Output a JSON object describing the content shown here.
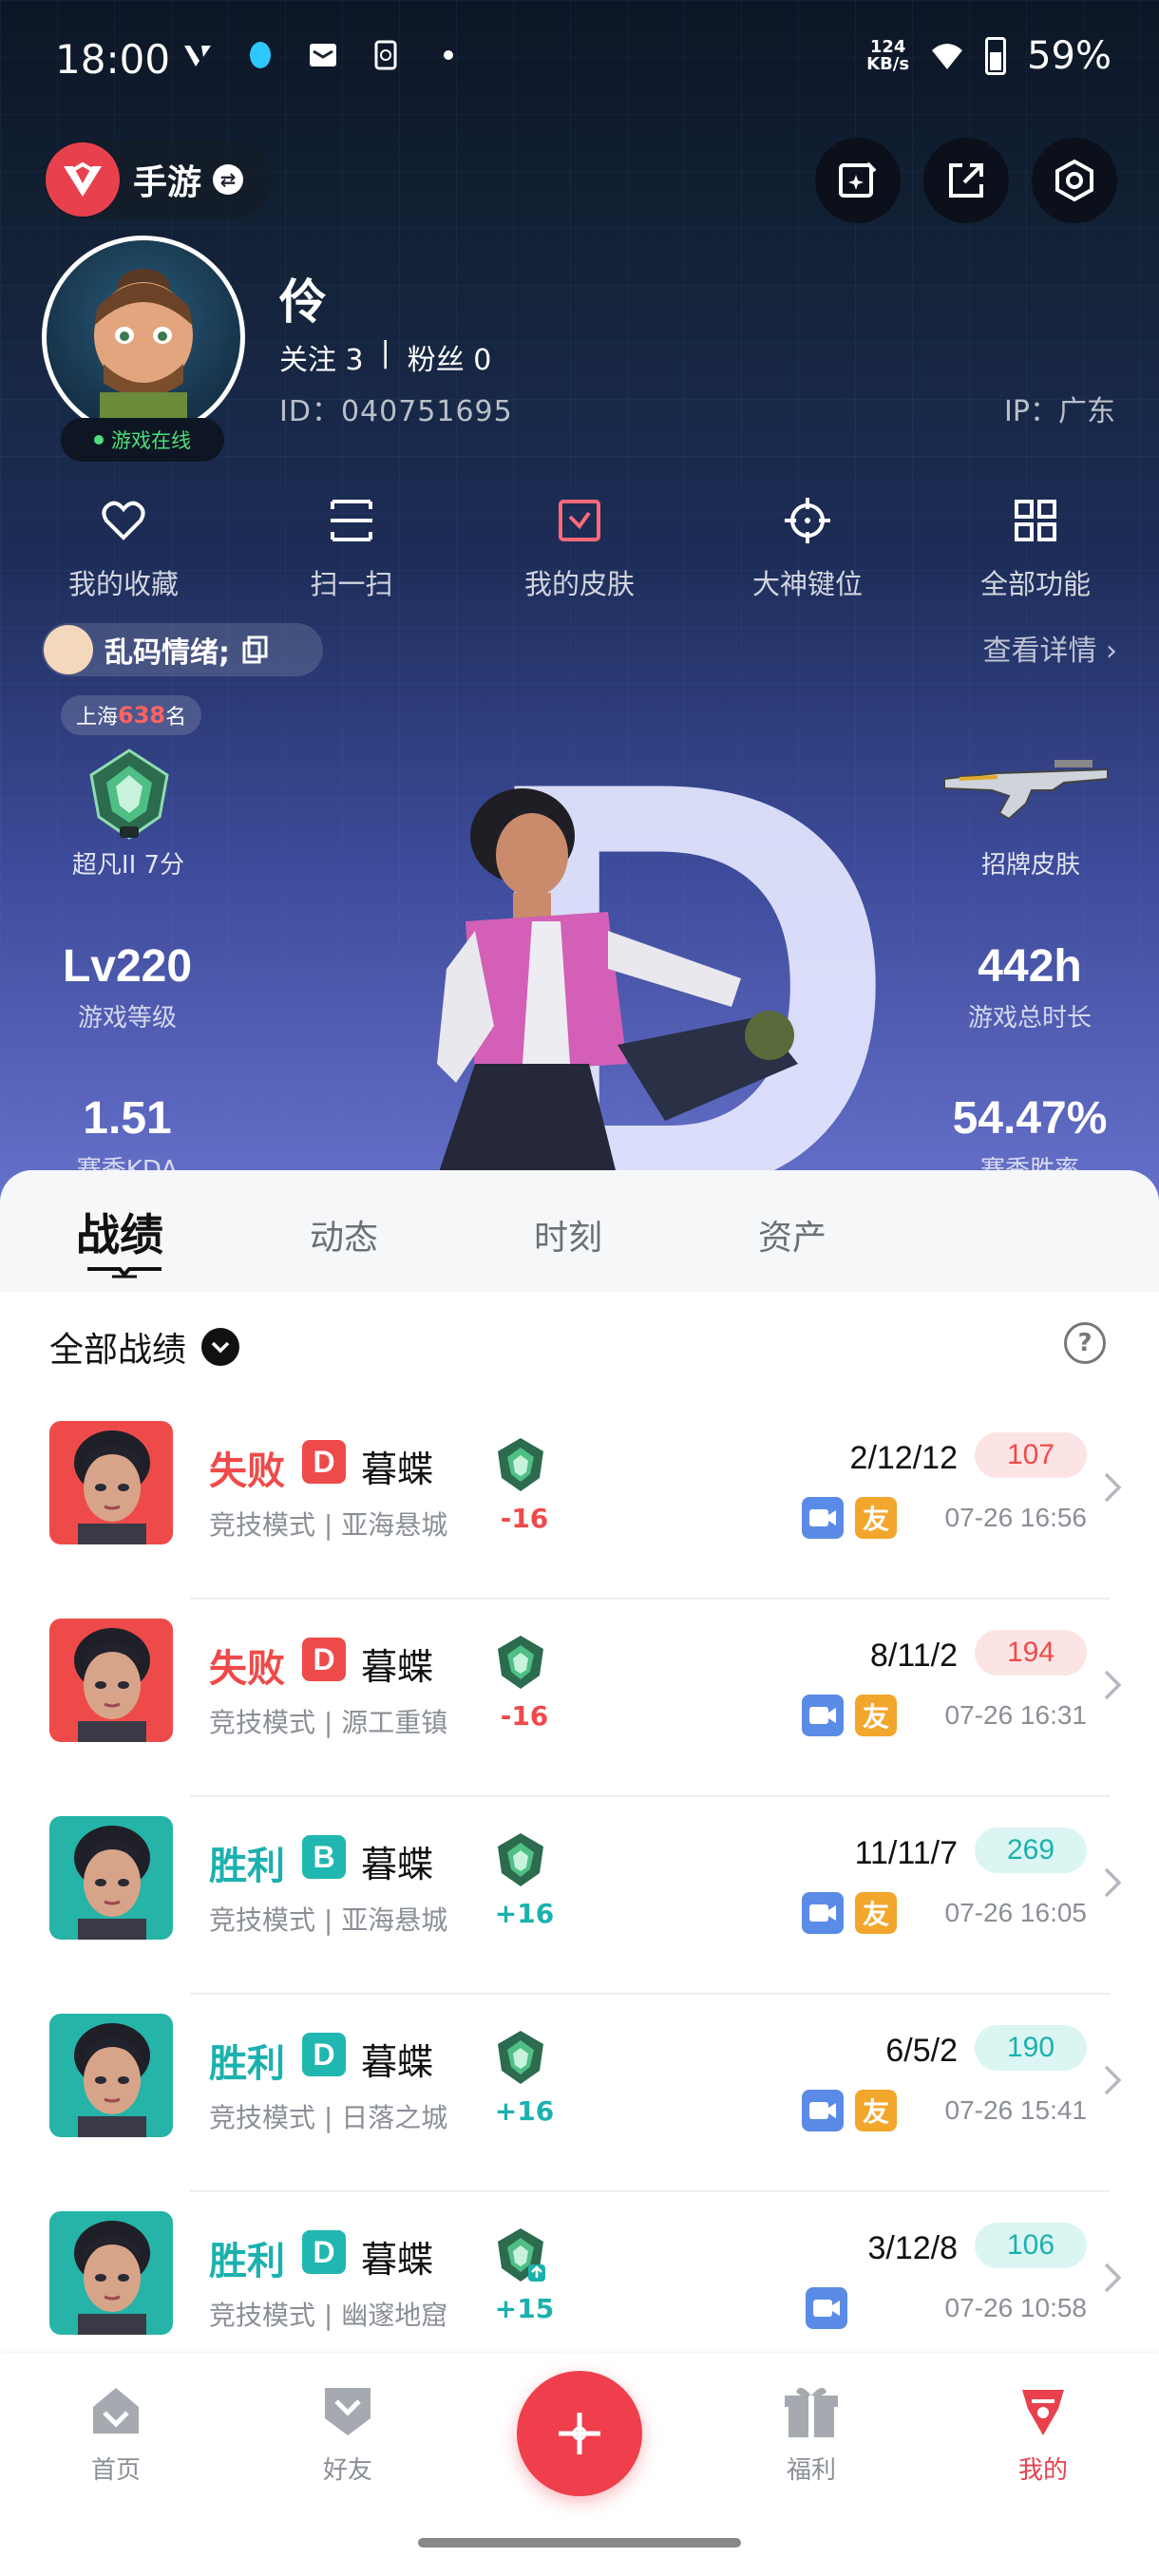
{
  "status_bar": {
    "time": "18:00",
    "speed_value": "124",
    "speed_unit": "KB/s",
    "battery": "59%"
  },
  "app_switcher": {
    "label": "手游"
  },
  "profile": {
    "name": "伶",
    "follow_label": "关注 3",
    "fans_label": "粉丝 0",
    "separator": "|",
    "id_label": "ID：040751695",
    "ip_label": "IP：广东",
    "online_status": "游戏在线"
  },
  "quick_actions": [
    {
      "label": "我的收藏",
      "icon": "heart-icon"
    },
    {
      "label": "扫一扫",
      "icon": "scan-icon"
    },
    {
      "label": "我的皮肤",
      "icon": "skin-icon"
    },
    {
      "label": "大神键位",
      "icon": "crosshair-icon"
    },
    {
      "label": "全部功能",
      "icon": "grid-icon"
    }
  ],
  "mood": {
    "text": "乱码情绪;",
    "view_detail": "查看详情"
  },
  "rank": {
    "region": "上海",
    "position": "638",
    "suffix": "名",
    "tier_label": "超凡II 7分"
  },
  "skin": {
    "label": "招牌皮肤"
  },
  "stats": {
    "level_value": "Lv220",
    "level_label": "游戏等级",
    "hours_value": "442h",
    "hours_label": "游戏总时长",
    "kda_value": "1.51",
    "kda_label": "赛季KDA",
    "winrate_value": "54.47%",
    "winrate_label": "赛季胜率"
  },
  "hero_letter": "D",
  "tabs": [
    "战绩",
    "动态",
    "时刻",
    "资产"
  ],
  "filter": {
    "label": "全部战绩"
  },
  "matches": [
    {
      "result": "失败",
      "grade": "D",
      "agent": "暮蝶",
      "mode": "竞技模式 | 亚海悬城",
      "delta": "-16",
      "kda": "2/12/12",
      "score": "107",
      "time": "07-26 16:56",
      "friend": "友",
      "outcome": "loss"
    },
    {
      "result": "失败",
      "grade": "D",
      "agent": "暮蝶",
      "mode": "竞技模式 | 源工重镇",
      "delta": "-16",
      "kda": "8/11/2",
      "score": "194",
      "time": "07-26 16:31",
      "friend": "友",
      "outcome": "loss"
    },
    {
      "result": "胜利",
      "grade": "B",
      "agent": "暮蝶",
      "mode": "竞技模式 | 亚海悬城",
      "delta": "+16",
      "kda": "11/11/7",
      "score": "269",
      "time": "07-26 16:05",
      "friend": "友",
      "outcome": "win"
    },
    {
      "result": "胜利",
      "grade": "D",
      "agent": "暮蝶",
      "mode": "竞技模式 | 日落之城",
      "delta": "+16",
      "kda": "6/5/2",
      "score": "190",
      "time": "07-26 15:41",
      "friend": "友",
      "outcome": "win"
    },
    {
      "result": "胜利",
      "grade": "D",
      "agent": "暮蝶",
      "mode": "竞技模式 | 幽邃地窟",
      "delta": "+15",
      "kda": "3/12/8",
      "score": "106",
      "time": "07-26 10:58",
      "friend": "",
      "outcome": "win"
    }
  ],
  "bottom_nav": [
    {
      "label": "首页",
      "icon": "home-icon"
    },
    {
      "label": "好友",
      "icon": "friends-icon"
    },
    {
      "label": "福利",
      "icon": "gift-icon"
    },
    {
      "label": "我的",
      "icon": "profile-icon"
    }
  ],
  "colors": {
    "brand": "#ef3f4c",
    "loss": "#ef4a4a",
    "win": "#1bb1ae",
    "video_icon": "#5a8be6",
    "friend_icon": "#f3a62c"
  }
}
